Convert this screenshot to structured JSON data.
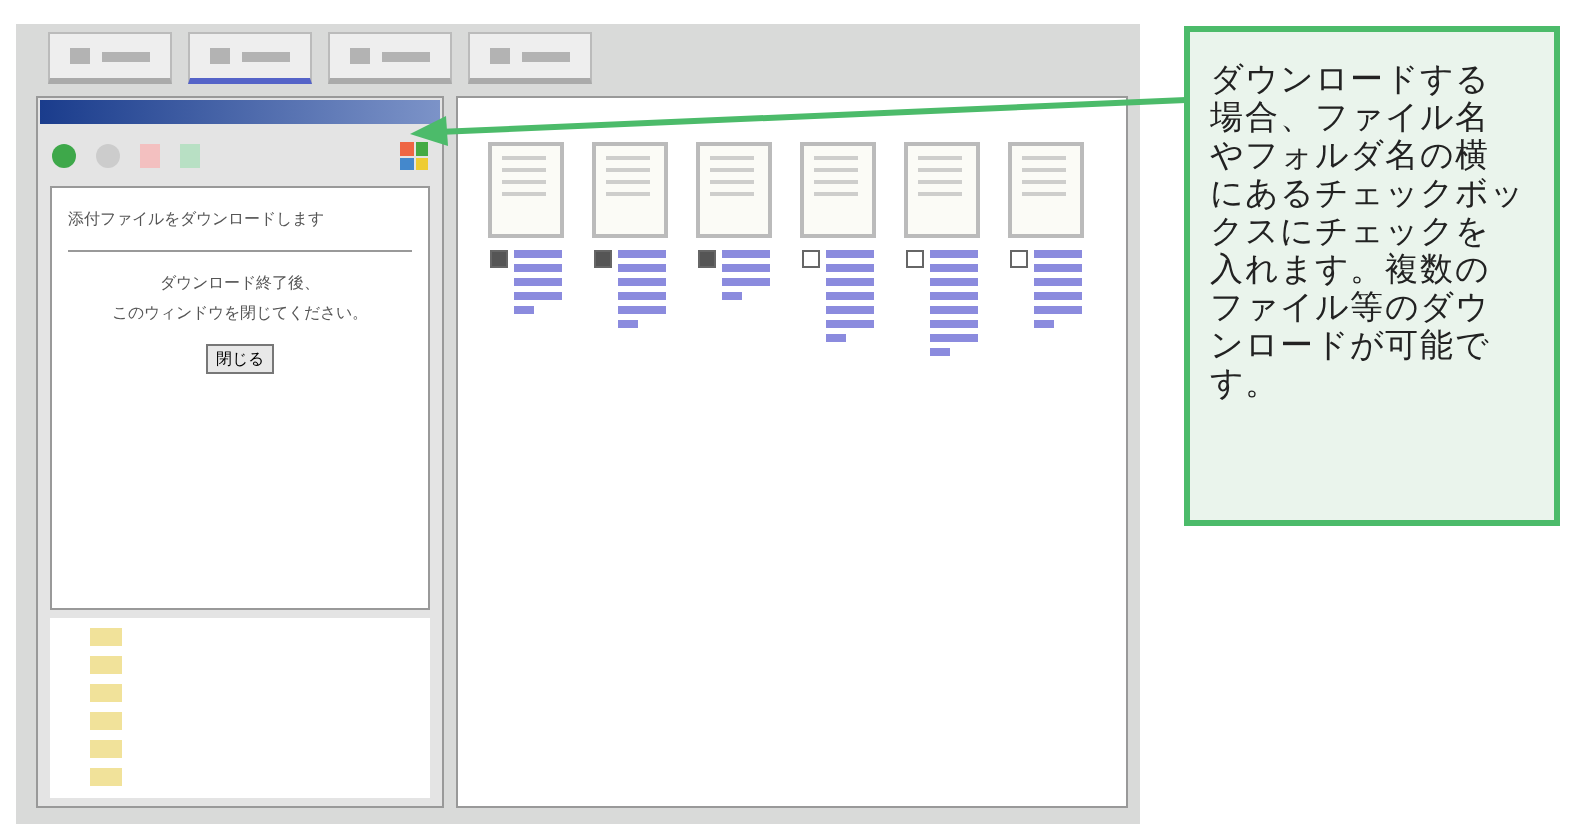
{
  "toolbar": {
    "tabs": [
      {
        "selected": false
      },
      {
        "selected": true
      },
      {
        "selected": false
      },
      {
        "selected": false
      }
    ]
  },
  "popup": {
    "message": "添付ファイルをダウンロードします",
    "notice": [
      "ダウンロード終了後、",
      "このウィンドウを閉じてください。"
    ],
    "close_button": "閉じる"
  },
  "files": [
    {
      "checked": true
    },
    {
      "checked": true
    },
    {
      "checked": true
    },
    {
      "checked": false
    },
    {
      "checked": false
    },
    {
      "checked": false
    }
  ],
  "callout": {
    "lines": [
      "ダウンロードする",
      "場合、ファイル名",
      "やフォルダ名の横",
      "にあるチェックボッ",
      "クスにチェックを",
      "入れます。複数の",
      "ファイル等のダウ",
      "ンロードが可能で",
      "す。"
    ]
  }
}
